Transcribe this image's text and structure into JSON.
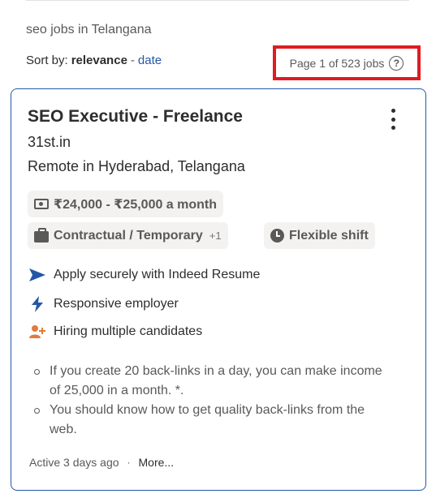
{
  "search_context": "seo jobs in Telangana",
  "sort": {
    "label": "Sort by:",
    "active": "relevance",
    "separator": "-",
    "alternate": "date"
  },
  "pagination": {
    "text": "Page 1 of 523 jobs",
    "help_icon": "question-circle-icon",
    "help_glyph": "?",
    "highlight_color": "#e01b22"
  },
  "job": {
    "title": "SEO Executive - Freelance",
    "company": "31st.in",
    "location": "Remote in Hyderabad, Telangana",
    "tags": {
      "salary": "₹24,000 - ₹25,000 a month",
      "job_type": "Contractual / Temporary",
      "job_type_extra": "+1",
      "shift": "Flexible shift"
    },
    "features": [
      {
        "label": "Apply securely with Indeed Resume",
        "icon": "send-arrow-icon"
      },
      {
        "label": "Responsive employer",
        "icon": "lightning-bolt-icon"
      },
      {
        "label": "Hiring multiple candidates",
        "icon": "add-person-icon"
      }
    ],
    "snippet": [
      "If you create 20 back-links in a day, you can make income of 25,000 in a month. *.",
      "You should know how to get quality back-links from the web."
    ],
    "footer": {
      "activity": "Active 3 days ago",
      "separator": "·",
      "more": "More..."
    }
  },
  "colors": {
    "accent_blue": "#2557a7",
    "text": "#2d2d2d",
    "muted": "#595959",
    "tag_bg": "#f3f2f1",
    "employer_icon": "#e07b39"
  }
}
